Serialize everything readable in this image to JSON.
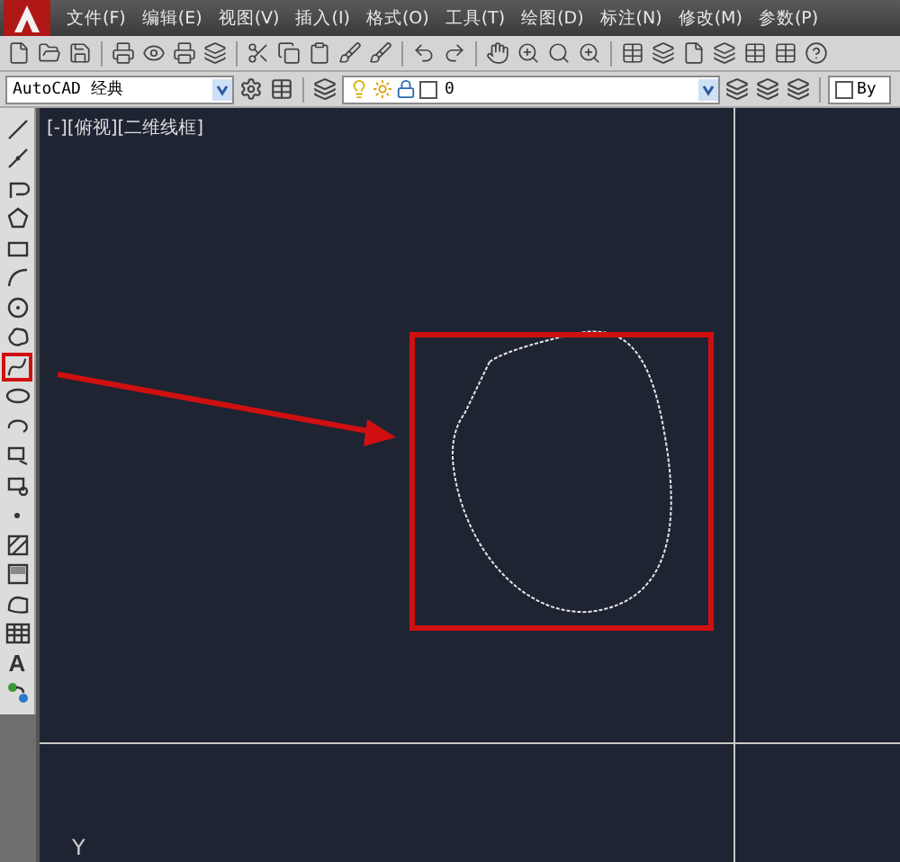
{
  "menu_bar": {
    "items": [
      "文件(F)",
      "编辑(E)",
      "视图(V)",
      "插入(I)",
      "格式(O)",
      "工具(T)",
      "绘图(D)",
      "标注(N)",
      "修改(M)",
      "参数(P)"
    ]
  },
  "workspace_dropdown": {
    "value": "AutoCAD 经典"
  },
  "layer_dropdown": {
    "value": "0"
  },
  "color_dropdown": {
    "value": "By"
  },
  "left_toolbar": {
    "tools": [
      {
        "kind": "line",
        "highlighted": false
      },
      {
        "kind": "xline",
        "highlighted": false
      },
      {
        "kind": "polyline",
        "highlighted": false
      },
      {
        "kind": "polygon",
        "highlighted": false
      },
      {
        "kind": "rectangle",
        "highlighted": false
      },
      {
        "kind": "arc",
        "highlighted": false
      },
      {
        "kind": "circle",
        "highlighted": false
      },
      {
        "kind": "cloud",
        "highlighted": false
      },
      {
        "kind": "spline",
        "highlighted": true
      },
      {
        "kind": "ellipse",
        "highlighted": false
      },
      {
        "kind": "ellipse-arc",
        "highlighted": false
      },
      {
        "kind": "insert",
        "highlighted": false
      },
      {
        "kind": "block",
        "highlighted": false
      },
      {
        "kind": "point",
        "highlighted": false
      },
      {
        "kind": "hatch",
        "highlighted": false
      },
      {
        "kind": "gradient",
        "highlighted": false
      },
      {
        "kind": "region",
        "highlighted": false
      },
      {
        "kind": "table",
        "highlighted": false
      },
      {
        "kind": "text",
        "label": "A",
        "highlighted": false
      },
      {
        "kind": "add-selected",
        "highlighted": false
      }
    ]
  },
  "viewport": {
    "label": "[-][俯视][二维线框]",
    "ucs_axis": "Y"
  }
}
